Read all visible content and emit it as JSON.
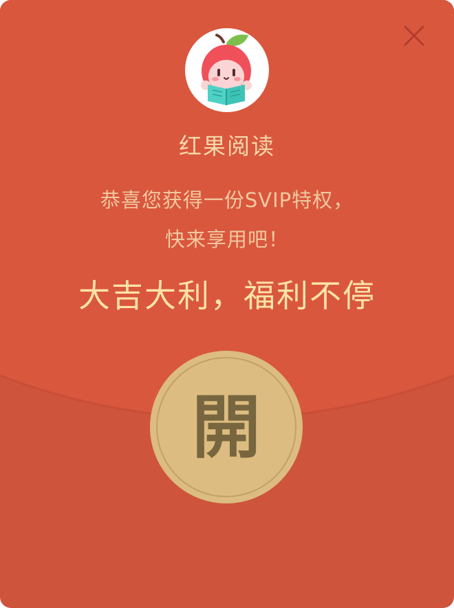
{
  "dialog": {
    "app_name": "红果阅读",
    "message_line_1": "恭喜您获得一份SVIP特权，",
    "message_line_2": "快来享用吧！",
    "slogan": "大吉大利，福利不停",
    "open_button_label": "開"
  },
  "icons": {
    "close": "close-icon",
    "avatar": "app-logo-icon"
  },
  "colors": {
    "envelope_top": "#d9573d",
    "envelope_bottom": "#cf543c",
    "text_light": "#f6d7a8",
    "slogan": "#fde3a4",
    "coin": "#dcbc80",
    "coin_text": "#77663f",
    "close_icon": "#b43c2c"
  }
}
